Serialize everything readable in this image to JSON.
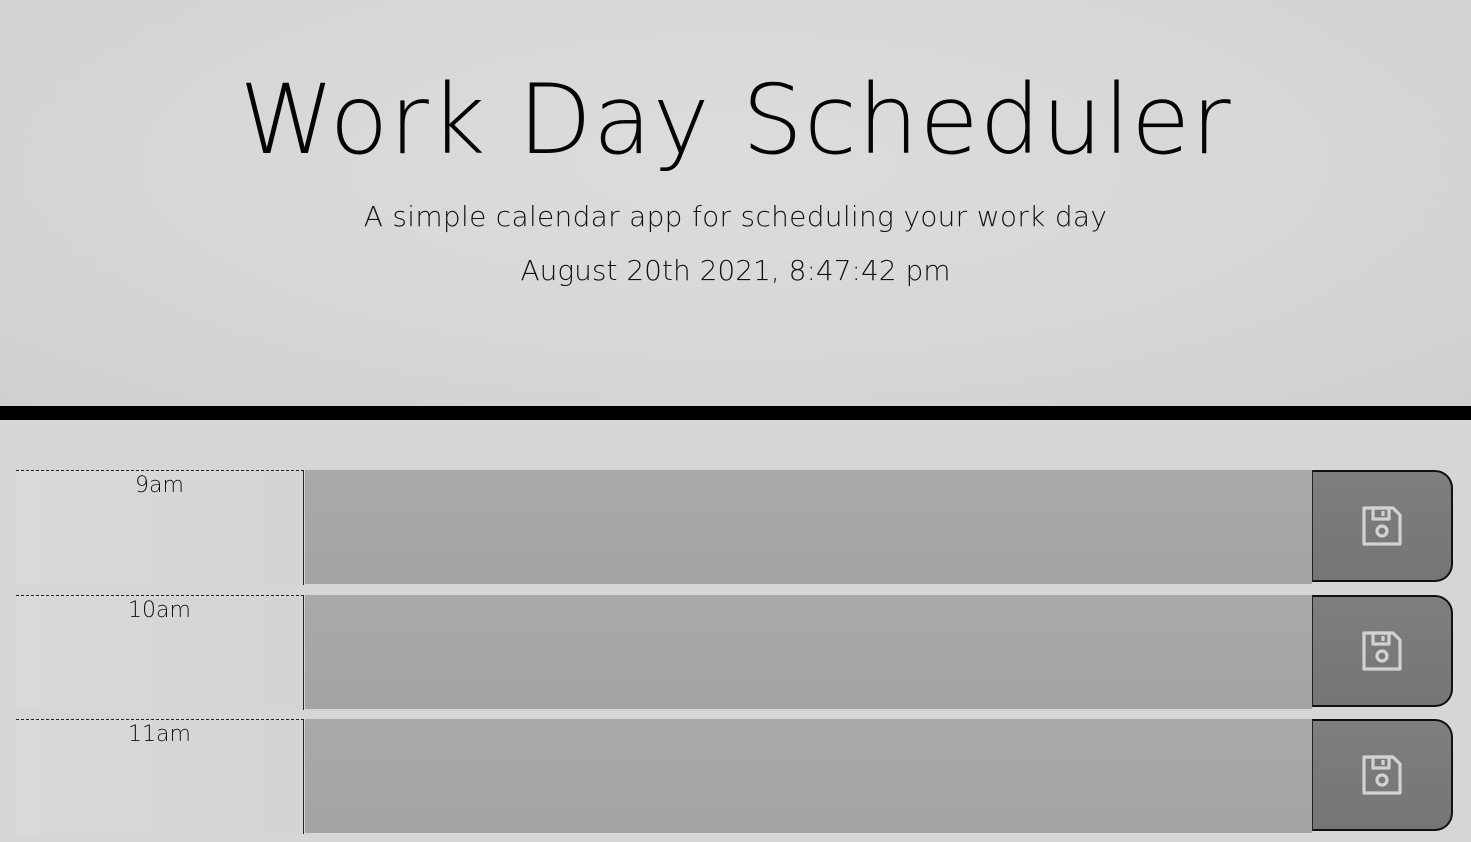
{
  "header": {
    "title": "Work Day Scheduler",
    "lead": "A simple calendar app for scheduling your work day",
    "current_day": "August 20th 2021, 8:47:42 pm"
  },
  "time_blocks": [
    {
      "hour": "9am",
      "description": "",
      "save_icon": "floppy-disk-icon"
    },
    {
      "hour": "10am",
      "description": "",
      "save_icon": "floppy-disk-icon"
    },
    {
      "hour": "11am",
      "description": "",
      "save_icon": "floppy-disk-icon"
    }
  ],
  "colors": {
    "background": "#d6d6d6",
    "divider": "#000000",
    "textarea": "#a8a8a8",
    "save_button": "#7a7a7a"
  }
}
